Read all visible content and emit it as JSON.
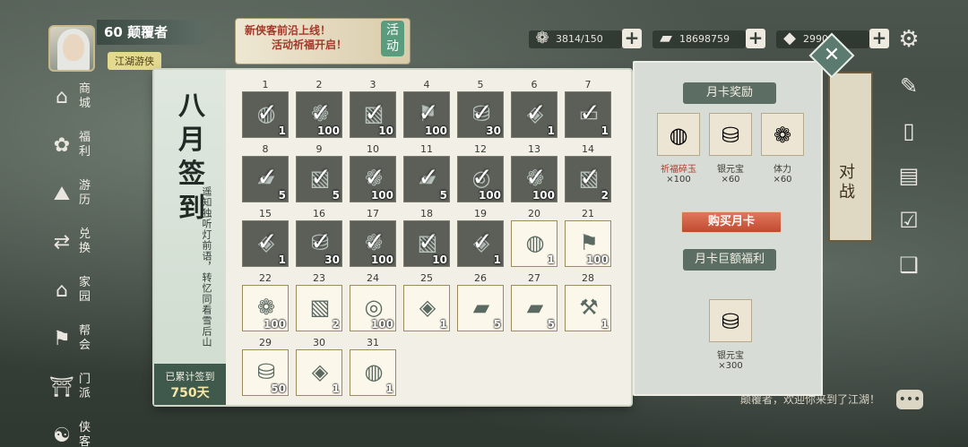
{
  "player": {
    "level": "60",
    "name": "颠覆者",
    "title": "江湖游侠"
  },
  "event": {
    "line1": "新侠客前沿上线！",
    "line2": "活动祈福开启！",
    "tag": "活动"
  },
  "resources": [
    {
      "icon": "stamina-icon",
      "glyph": "❁",
      "value": "3814/150"
    },
    {
      "icon": "ingot-icon",
      "glyph": "▰",
      "value": "18698759"
    },
    {
      "icon": "gold-icon",
      "glyph": "◆",
      "value": "2990"
    }
  ],
  "left_menu": [
    {
      "id": "shop",
      "label": "商城",
      "glyph": "⌂"
    },
    {
      "id": "welfare",
      "label": "福利",
      "glyph": "✿"
    },
    {
      "id": "travel",
      "label": "游历",
      "glyph": "⛰"
    },
    {
      "id": "exchange",
      "label": "兑换",
      "glyph": "⇄"
    },
    {
      "id": "home",
      "label": "家园",
      "glyph": "⌂"
    },
    {
      "id": "guild",
      "label": "帮会",
      "glyph": "⚑"
    },
    {
      "id": "sect",
      "label": "门派",
      "glyph": "⛩"
    },
    {
      "id": "hero",
      "label": "侠客",
      "glyph": "☯"
    }
  ],
  "right_icons": [
    {
      "name": "scroll-icon",
      "glyph": "✎"
    },
    {
      "name": "card-icon",
      "glyph": "▯"
    },
    {
      "name": "book-icon",
      "glyph": "▤"
    },
    {
      "name": "task-icon",
      "glyph": "☑"
    },
    {
      "name": "journal-icon",
      "glyph": "❑"
    }
  ],
  "bg_scroll_text": "对战",
  "signin": {
    "title": "八月签到",
    "poem": "遥知独听灯前语，转忆同看雪后山",
    "total_label": "已累计签到",
    "total_value": "750天",
    "days": [
      {
        "day": "1",
        "qty": "1",
        "glyph": "◍",
        "signed": true
      },
      {
        "day": "2",
        "qty": "100",
        "glyph": "❁",
        "signed": true
      },
      {
        "day": "3",
        "qty": "10",
        "glyph": "▧",
        "signed": true
      },
      {
        "day": "4",
        "qty": "100",
        "glyph": "⚑",
        "signed": true
      },
      {
        "day": "5",
        "qty": "30",
        "glyph": "⛁",
        "signed": true
      },
      {
        "day": "6",
        "qty": "1",
        "glyph": "◈",
        "signed": true
      },
      {
        "day": "7",
        "qty": "1",
        "glyph": "▭",
        "signed": true
      },
      {
        "day": "8",
        "qty": "5",
        "glyph": "▰",
        "signed": true
      },
      {
        "day": "9",
        "qty": "5",
        "glyph": "▧",
        "signed": true
      },
      {
        "day": "10",
        "qty": "100",
        "glyph": "❁",
        "signed": true
      },
      {
        "day": "11",
        "qty": "5",
        "glyph": "▰",
        "signed": true
      },
      {
        "day": "12",
        "qty": "100",
        "glyph": "◎",
        "signed": true
      },
      {
        "day": "13",
        "qty": "100",
        "glyph": "❁",
        "signed": true
      },
      {
        "day": "14",
        "qty": "2",
        "glyph": "▧",
        "signed": true
      },
      {
        "day": "15",
        "qty": "1",
        "glyph": "◈",
        "signed": true
      },
      {
        "day": "16",
        "qty": "30",
        "glyph": "⛁",
        "signed": true
      },
      {
        "day": "17",
        "qty": "100",
        "glyph": "❁",
        "signed": true
      },
      {
        "day": "18",
        "qty": "10",
        "glyph": "▧",
        "signed": true
      },
      {
        "day": "19",
        "qty": "1",
        "glyph": "◈",
        "signed": true
      },
      {
        "day": "20",
        "qty": "1",
        "glyph": "◍",
        "signed": false
      },
      {
        "day": "21",
        "qty": "100",
        "glyph": "⚑",
        "signed": false
      },
      {
        "day": "22",
        "qty": "100",
        "glyph": "❁",
        "signed": false
      },
      {
        "day": "23",
        "qty": "2",
        "glyph": "▧",
        "signed": false
      },
      {
        "day": "24",
        "qty": "100",
        "glyph": "◎",
        "signed": false
      },
      {
        "day": "25",
        "qty": "1",
        "glyph": "◈",
        "signed": false
      },
      {
        "day": "26",
        "qty": "5",
        "glyph": "▰",
        "signed": false
      },
      {
        "day": "27",
        "qty": "5",
        "glyph": "▰",
        "signed": false
      },
      {
        "day": "28",
        "qty": "1",
        "glyph": "⚒",
        "signed": false
      },
      {
        "day": "29",
        "qty": "50",
        "glyph": "⛁",
        "signed": false
      },
      {
        "day": "30",
        "qty": "1",
        "glyph": "◈",
        "signed": false
      },
      {
        "day": "31",
        "qty": "1",
        "glyph": "◍",
        "signed": false
      }
    ]
  },
  "month_card": {
    "reward_title": "月卡奖励",
    "rewards": [
      {
        "name": "祈福碎玉",
        "count": "×100",
        "glyph": "◍",
        "highlight": true
      },
      {
        "name": "银元宝",
        "count": "×60",
        "glyph": "⛁",
        "highlight": false
      },
      {
        "name": "体力",
        "count": "×60",
        "glyph": "❁",
        "highlight": false
      }
    ],
    "buy_label": "购买月卡",
    "bonus_title": "月卡巨额福利",
    "bonus": {
      "name": "银元宝",
      "count": "×300",
      "glyph": "⛁"
    }
  },
  "chat": {
    "text": "颠覆者，欢迎你来到了江湖！"
  },
  "colors": {
    "signed_cell": "#5b5f58",
    "accent_green": "#3f5a4c",
    "buy_button": "#c04a32"
  }
}
